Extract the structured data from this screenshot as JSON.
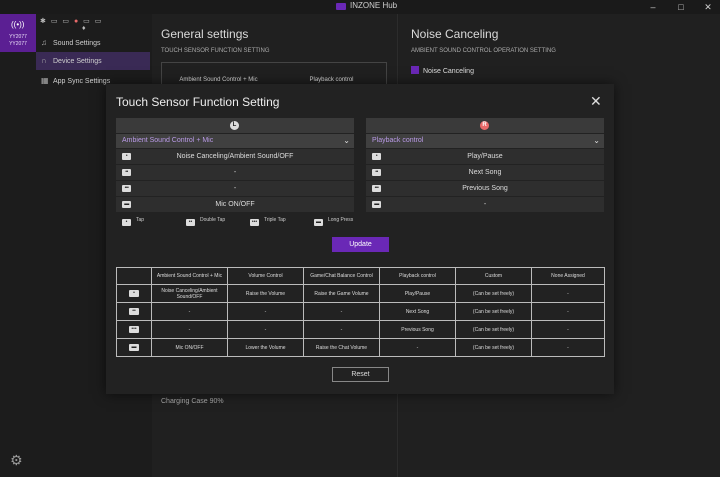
{
  "window": {
    "title": "INZONE Hub",
    "controls": [
      "–",
      "□",
      "✕"
    ]
  },
  "sidebar": {
    "device_label": "YY2077",
    "device_label_2": "YY2077",
    "nav": [
      {
        "label": "Sound Settings",
        "icon": "music-note-icon"
      },
      {
        "label": "Device Settings",
        "icon": "headphones-icon",
        "active": true
      },
      {
        "label": "App Sync Settings",
        "icon": "grid-icon"
      }
    ]
  },
  "background": {
    "general_title": "General settings",
    "touch_sub": "TOUCH SENSOR FUNCTION SETTING",
    "card_left": "Ambient Sound Control + Mic",
    "card_right": "Playback control",
    "charging": "Charging Case  90%",
    "nc_title": "Noise Canceling",
    "nc_sub": "AMBIENT SOUND CONTROL OPERATION SETTING",
    "nc_check": "Noise Canceling"
  },
  "modal": {
    "title": "Touch Sensor Function Setting",
    "left": {
      "badge": "L",
      "selected": "Ambient Sound Control + Mic",
      "rows": [
        "Noise Canceling/Ambient Sound/OFF",
        "-",
        "-",
        "Mic ON/OFF"
      ]
    },
    "right": {
      "badge": "R",
      "selected": "Playback control",
      "rows": [
        "Play/Pause",
        "Next Song",
        "Previous Song",
        "-"
      ]
    },
    "legend": [
      "Tap",
      "Double Tap",
      "Triple Tap",
      "Long Press"
    ],
    "update_label": "Update",
    "table": {
      "headers": [
        "",
        "Ambient Sound Control + Mic",
        "Volume Control",
        "Game/Chat Balance Control",
        "Playback control",
        "Custom",
        "None Assigned"
      ],
      "rows": [
        [
          "",
          "Noise Canceling/Ambient Sound/OFF",
          "Raise the Volume",
          "Raise the Game Volume",
          "Play/Pause",
          "(Can be set freely)",
          "-"
        ],
        [
          "",
          "-",
          "-",
          "-",
          "Next Song",
          "(Can be set freely)",
          "-"
        ],
        [
          "",
          "-",
          "-",
          "-",
          "Previous Song",
          "(Can be set freely)",
          "-"
        ],
        [
          "",
          "Mic ON/OFF",
          "Lower the Volume",
          "Raise the Chat Volume",
          "-",
          "(Can be set freely)",
          "-"
        ]
      ]
    },
    "reset_label": "Reset"
  }
}
